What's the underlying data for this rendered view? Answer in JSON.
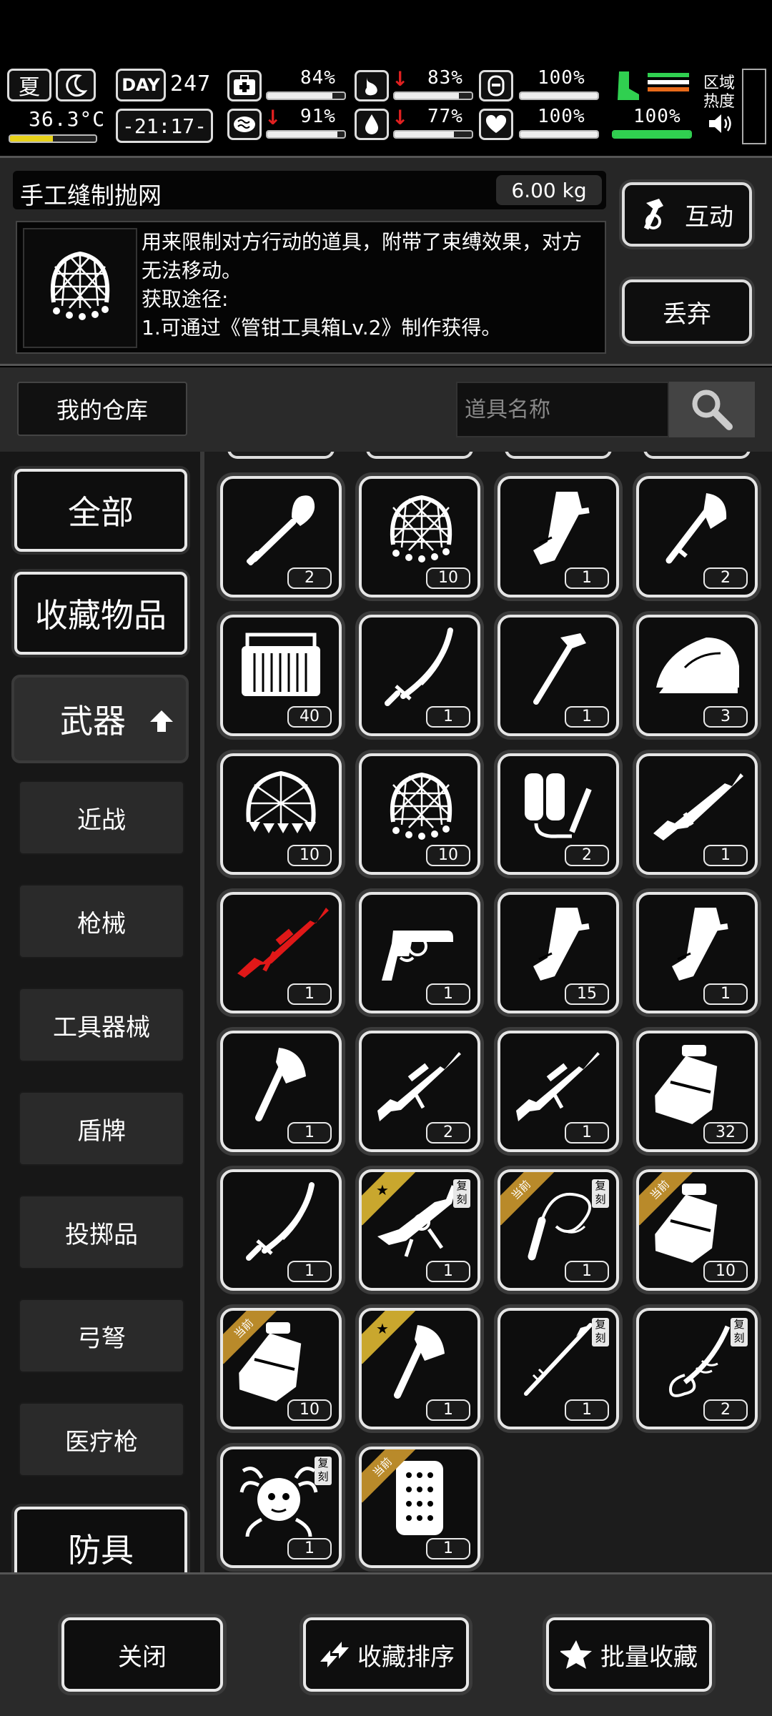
{
  "status": {
    "season": "夏",
    "day_label": "DAY",
    "day_value": "247",
    "temperature": "36.3°C",
    "time": "-21:17-",
    "zone_label": "区域\n热度",
    "stats": [
      {
        "icon": "medkit-icon",
        "value": "84%",
        "fill": 0.84
      },
      {
        "icon": "stomach-icon",
        "value": "83%",
        "fill": 0.83,
        "down": true
      },
      {
        "icon": "shield-head-icon",
        "value": "100%",
        "fill": 1.0
      },
      {
        "icon": "brain-icon",
        "value": "91%",
        "fill": 0.91,
        "down": true
      },
      {
        "icon": "water-drop-icon",
        "value": "77%",
        "fill": 0.77,
        "down": true
      },
      {
        "icon": "heart-icon",
        "value": "100%",
        "fill": 1.0
      }
    ],
    "stamina": {
      "value": "100%",
      "fill": 1.0
    }
  },
  "item": {
    "name": "手工缝制抛网",
    "weight": "6.00 kg",
    "description": "用来限制对方行动的道具，附带了束缚效果，对方无法移动。\n获取途径:\n1.可通过《管钳工具箱Lv.2》制作获得。"
  },
  "actions": {
    "interact": "互动",
    "discard": "丢弃"
  },
  "warehouse": {
    "title": "我的仓库",
    "search_placeholder": "道具名称"
  },
  "categories": {
    "all": "全部",
    "favorites": "收藏物品",
    "weapons": "武器",
    "armor": "防具",
    "subs": [
      "近战",
      "枪械",
      "工具器械",
      "盾牌",
      "投掷品",
      "弓弩",
      "医疗枪"
    ]
  },
  "items": [
    {
      "art": "shovel",
      "count": "2"
    },
    {
      "art": "net",
      "count": "10"
    },
    {
      "art": "machete",
      "count": "1"
    },
    {
      "art": "hatchet",
      "count": "2"
    },
    {
      "art": "ammo-box",
      "count": "40"
    },
    {
      "art": "katana",
      "count": "1"
    },
    {
      "art": "hammer",
      "count": "1"
    },
    {
      "art": "iron",
      "count": "3"
    },
    {
      "art": "spiked-net",
      "count": "10"
    },
    {
      "art": "net",
      "count": "10"
    },
    {
      "art": "flamethrower",
      "count": "2"
    },
    {
      "art": "rifle",
      "count": "1"
    },
    {
      "art": "rifle-red",
      "count": "1"
    },
    {
      "art": "revolver",
      "count": "1"
    },
    {
      "art": "machete",
      "count": "15"
    },
    {
      "art": "machete",
      "count": "1"
    },
    {
      "art": "axe",
      "count": "1"
    },
    {
      "art": "sniper",
      "count": "2"
    },
    {
      "art": "sniper",
      "count": "1"
    },
    {
      "art": "bottle",
      "count": "32"
    },
    {
      "art": "katana",
      "count": "1"
    },
    {
      "art": "heavy-gun",
      "count": "1",
      "badge": "star",
      "fuke": "复刻"
    },
    {
      "art": "whip",
      "count": "1",
      "badge": "当前",
      "fuke": "复刻"
    },
    {
      "art": "bottle",
      "count": "10",
      "badge": "当前"
    },
    {
      "art": "bottle",
      "count": "10",
      "badge": "当前"
    },
    {
      "art": "axe",
      "count": "1",
      "badge": "star"
    },
    {
      "art": "spear",
      "count": "1",
      "fuke": "复刻"
    },
    {
      "art": "dragon-blade",
      "count": "2",
      "fuke": "复刻"
    },
    {
      "art": "medusa",
      "count": "1",
      "fuke": "复刻"
    },
    {
      "art": "riot-shield",
      "count": "1",
      "badge": "当前"
    }
  ],
  "footer": {
    "close": "关闭",
    "sort": "收藏排序",
    "batch": "批量收藏"
  }
}
